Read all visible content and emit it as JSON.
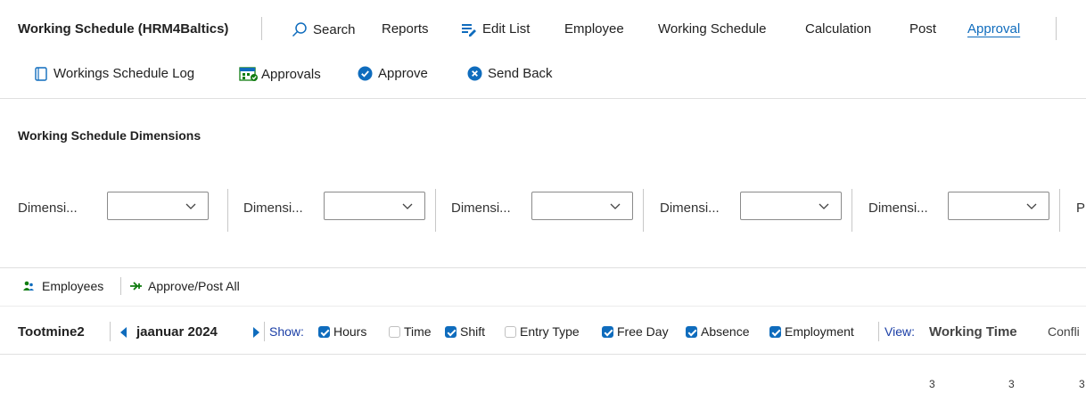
{
  "header": {
    "title": "Working Schedule (HRM4Baltics)",
    "search": "Search",
    "reports": "Reports",
    "edit_list": "Edit List",
    "employee": "Employee",
    "working_schedule": "Working Schedule",
    "calculation": "Calculation",
    "post": "Post",
    "approval": "Approval"
  },
  "subbar": {
    "log": "Workings Schedule Log",
    "approvals": "Approvals",
    "approve": "Approve",
    "send_back": "Send Back"
  },
  "dimensions": {
    "heading": "Working Schedule Dimensions",
    "labels": [
      "Dimensi...",
      "Dimensi...",
      "Dimensi...",
      "Dimensi...",
      "Dimensi..."
    ],
    "cut_label": "P"
  },
  "toolbar": {
    "employees": "Employees",
    "approve_post_all": "Approve/Post All"
  },
  "schedule_bar": {
    "name": "Tootmine2",
    "month": "jaanuar 2024",
    "show_label": "Show:",
    "options": [
      {
        "label": "Hours",
        "checked": true
      },
      {
        "label": "Time",
        "checked": false
      },
      {
        "label": "Shift",
        "checked": true
      },
      {
        "label": "Entry Type",
        "checked": false
      },
      {
        "label": "Free Day",
        "checked": true
      },
      {
        "label": "Absence",
        "checked": true
      },
      {
        "label": "Employment",
        "checked": true
      }
    ],
    "view_label": "View:",
    "view_value": "Working Time",
    "conflict": "Confli"
  },
  "grid": {
    "day_numbers": [
      "3",
      "3",
      "3"
    ]
  },
  "colors": {
    "accent": "#0f6cbd",
    "approve_green": "#107c10",
    "link_blue": "#1a3ea6"
  }
}
